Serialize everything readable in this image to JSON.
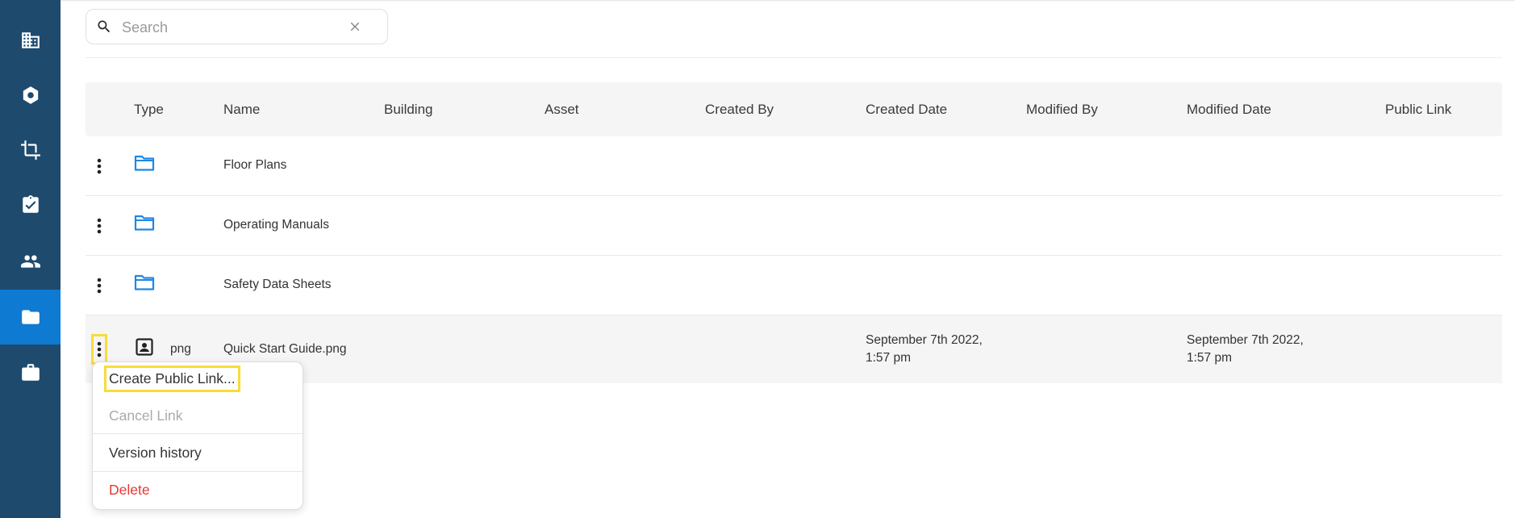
{
  "search": {
    "placeholder": "Search",
    "value": ""
  },
  "sidebar": {
    "items": [
      {
        "icon": "building-icon",
        "active": false
      },
      {
        "icon": "hexagon-icon",
        "active": false
      },
      {
        "icon": "crop-icon",
        "active": false
      },
      {
        "icon": "clipboard-check-icon",
        "active": false
      },
      {
        "icon": "people-icon",
        "active": false
      },
      {
        "icon": "folder-icon",
        "active": true
      },
      {
        "icon": "briefcase-icon",
        "active": false
      }
    ]
  },
  "table": {
    "columns": [
      "Type",
      "Name",
      "Building",
      "Asset",
      "Created By",
      "Created Date",
      "Modified By",
      "Modified Date",
      "Public Link"
    ],
    "rows": [
      {
        "type": "folder",
        "type_label": "",
        "name": "Floor Plans",
        "building": "",
        "asset": "",
        "created_by": "",
        "created_date_1": "",
        "created_date_2": "",
        "modified_by": "",
        "modified_date_1": "",
        "modified_date_2": "",
        "public_link": ""
      },
      {
        "type": "folder",
        "type_label": "",
        "name": "Operating Manuals",
        "building": "",
        "asset": "",
        "created_by": "",
        "created_date_1": "",
        "created_date_2": "",
        "modified_by": "",
        "modified_date_1": "",
        "modified_date_2": "",
        "public_link": ""
      },
      {
        "type": "folder",
        "type_label": "",
        "name": "Safety Data Sheets",
        "building": "",
        "asset": "",
        "created_by": "",
        "created_date_1": "",
        "created_date_2": "",
        "modified_by": "",
        "modified_date_1": "",
        "modified_date_2": "",
        "public_link": ""
      },
      {
        "type": "file",
        "type_label": "png",
        "name": "Quick Start Guide.png",
        "building": "",
        "asset": "",
        "created_by": "",
        "created_date_1": "September 7th 2022,",
        "created_date_2": "1:57 pm",
        "modified_by": "",
        "modified_date_1": "September 7th 2022,",
        "modified_date_2": "1:57 pm",
        "public_link": ""
      }
    ]
  },
  "context_menu": {
    "items": [
      {
        "label": "Create Public Link...",
        "state": "highlighted"
      },
      {
        "label": "Cancel Link",
        "state": "disabled"
      },
      {
        "label": "Version history",
        "state": "normal"
      },
      {
        "label": "Delete",
        "state": "danger"
      }
    ]
  },
  "colors": {
    "sidebar_bg": "#1e4a6e",
    "sidebar_active": "#0f7ad2",
    "folder_icon": "#1e88e5",
    "highlight": "#f7dc3a",
    "danger": "#e53935"
  }
}
